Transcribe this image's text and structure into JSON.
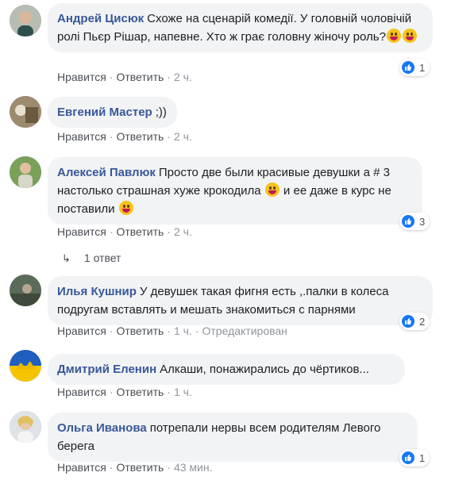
{
  "actions": {
    "like": "Нравится",
    "reply": "Ответить",
    "separator": "·"
  },
  "comments": [
    {
      "author": "Андрей Цисюк",
      "text": "Схоже на сценарій комедії. У головній чоловічій ролі Пьєр Рішар, напевне. Хто ж грає головну жіночу роль?",
      "time": "2 ч.",
      "likes": "1",
      "edited": ""
    },
    {
      "author": "Евгений Мастер",
      "text": ";))",
      "time": "2 ч.",
      "likes": "",
      "edited": ""
    },
    {
      "author": "Алексей Павлюк",
      "text": "Просто две были красивые девушки а # 3 настолько страшная хуже крокодила",
      "text2": " и ее даже в курс не поставили",
      "time": "2 ч.",
      "likes": "3",
      "edited": ""
    },
    {
      "author": "Илья Кушнир",
      "text": "У девушек такая фигня есть ,.палки в колеса подругам вставлять и мешать знакомиться с парнями",
      "time": "1 ч.",
      "likes": "2",
      "edited": "Отредактирован"
    },
    {
      "author": "Дмитрий Еленин",
      "text": "Алкаши, понажирались до чёртиков...",
      "time": "1 ч.",
      "likes": "",
      "edited": ""
    },
    {
      "author": "Ольга Иванова",
      "text": "потрепали нервы всем родителям Левого берега",
      "time": "43 мин.",
      "likes": "1",
      "edited": ""
    }
  ],
  "replies_link": "1 ответ",
  "colors": {
    "author": "#385898",
    "like": "#1877f2",
    "bubble": "#f2f3f5",
    "meta": "#90949c"
  }
}
